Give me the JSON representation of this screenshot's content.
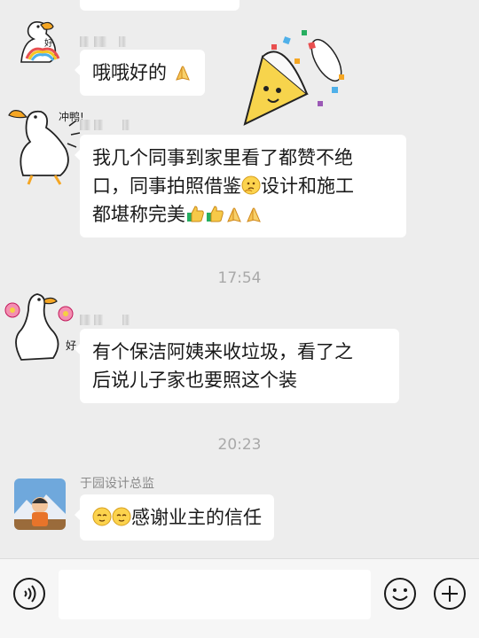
{
  "messages": [
    {
      "text": "哦哦好的"
    },
    {
      "text_line1": "我几个同事到家里看了都赞不绝",
      "text_line2a": "口，同事拍照借鉴",
      "text_line2b": "设计和施工",
      "text_line3": "都堪称完美"
    },
    {
      "text_line1": "有个保洁阿姨来收垃圾，看了之",
      "text_line2": "后说儿子家也要照这个装"
    },
    {
      "sender": "于园设计总监",
      "text": "感谢业主的信任"
    }
  ],
  "timestamps": [
    "17:54",
    "20:23"
  ],
  "sticker_labels": {
    "rainbow": "好",
    "goose_run": "冲鸭!",
    "goose_flower": "好"
  },
  "icons": {
    "voice": "voice-icon",
    "emoji": "emoji-icon",
    "plus": "plus-icon"
  },
  "colors": {
    "background": "#ededed",
    "bubble": "#ffffff",
    "timestamp": "#a9a9a9",
    "sender_name": "#8a8a8a"
  }
}
